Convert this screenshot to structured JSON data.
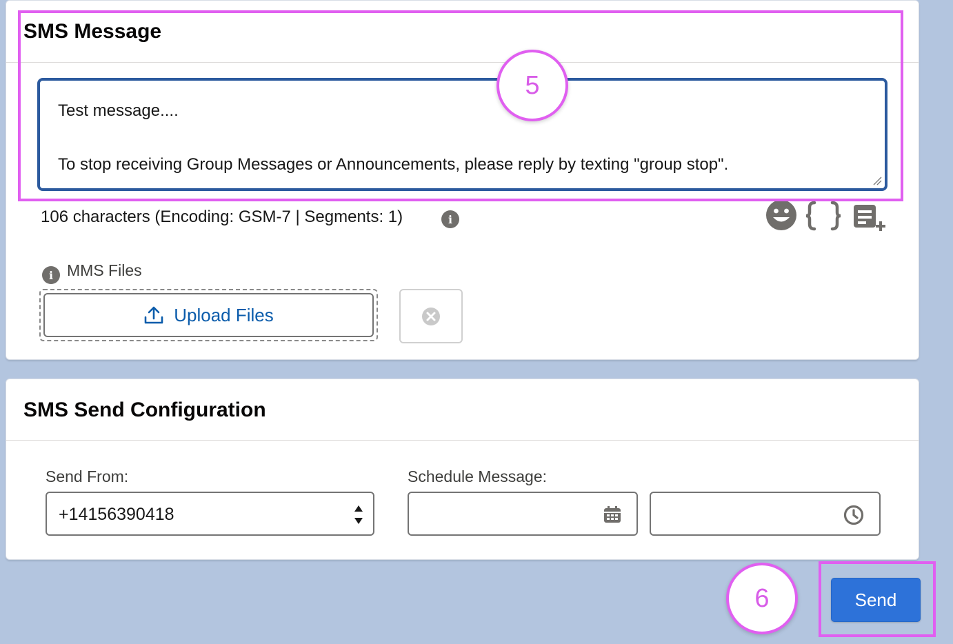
{
  "sms_message": {
    "title": "SMS Message",
    "message_line1": "Test message....",
    "message_line2": "To stop receiving Group Messages or Announcements, please reply by texting \"group stop\".",
    "char_count_text": "106 characters (Encoding: GSM-7 | Segments: 1)",
    "tools": [
      "smiley-icon",
      "merge-field-braces-icon",
      "add-template-icon"
    ],
    "mms_label": "MMS Files",
    "upload_label": "Upload Files"
  },
  "send_config": {
    "title": "SMS Send Configuration",
    "send_from_label": "Send From:",
    "send_from_value": "+14156390418",
    "schedule_label": "Schedule Message:",
    "date_value": "",
    "time_value": ""
  },
  "actions": {
    "send_label": "Send"
  },
  "annotations": {
    "step_message": "5",
    "step_send": "6"
  },
  "colors": {
    "accent": "#2d72d9",
    "focus_border": "#2c5a9e",
    "annotation": "#e05ff0",
    "background": "#b3c5df"
  }
}
